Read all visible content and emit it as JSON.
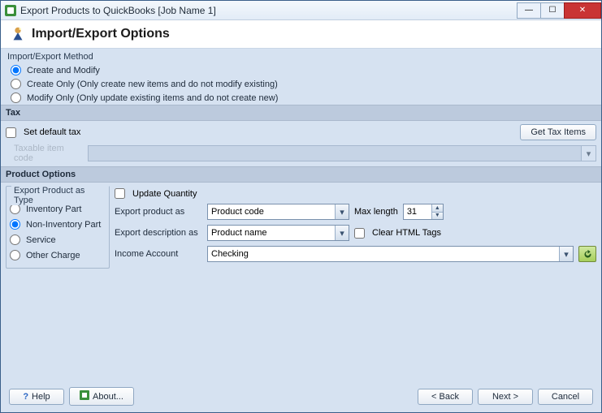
{
  "window": {
    "title": "Export Products to QuickBooks [Job Name 1]"
  },
  "header": {
    "title": "Import/Export Options"
  },
  "method": {
    "section_label": "Import/Export Method",
    "options": {
      "create_modify": "Create and Modify",
      "create_only": "Create Only (Only create new items and do not modify existing)",
      "modify_only": "Modify Only (Only update existing items and do not create new)"
    },
    "selected": "create_modify"
  },
  "tax": {
    "band": "Tax",
    "set_default": "Set default tax",
    "get_items_btn": "Get Tax Items",
    "taxable_label": "Taxable item code"
  },
  "product_options": {
    "band": "Product Options",
    "type_group": {
      "legend": "Export Product as Type",
      "options": {
        "inventory": "Inventory Part",
        "noninventory": "Non-Inventory Part",
        "service": "Service",
        "other": "Other Charge"
      },
      "selected": "noninventory"
    },
    "update_qty": "Update Quantity",
    "rows": {
      "export_product_as": {
        "label": "Export product as",
        "value": "Product code"
      },
      "max_length": {
        "label": "Max length",
        "value": "31"
      },
      "export_desc_as": {
        "label": "Export description as",
        "value": "Product name"
      },
      "clear_html": "Clear HTML Tags",
      "income_account": {
        "label": "Income Account",
        "value": "Checking"
      }
    }
  },
  "footer": {
    "help": "Help",
    "about": "About...",
    "back": "< Back",
    "next": "Next >",
    "cancel": "Cancel"
  }
}
